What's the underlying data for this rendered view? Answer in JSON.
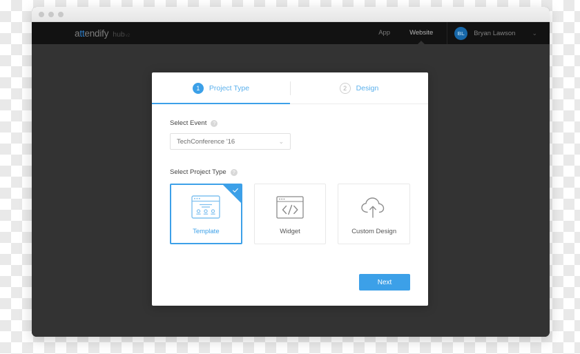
{
  "browser": {
    "traffic_lights": [
      "close",
      "minimize",
      "maximize"
    ]
  },
  "navbar": {
    "logo": {
      "prefix": "a",
      "accent": "tt",
      "suffix": "endify",
      "product": "hub",
      "superscript": "v2"
    },
    "links": [
      {
        "label": "App",
        "active": false
      },
      {
        "label": "Website",
        "active": true
      }
    ],
    "user": {
      "initials": "BL",
      "name": "Bryan Lawson",
      "chevron": "⌄"
    }
  },
  "modal": {
    "tabs": [
      {
        "number": "1",
        "label": "Project Type",
        "state": "active"
      },
      {
        "number": "2",
        "label": "Design",
        "state": "inactive"
      }
    ],
    "select_event": {
      "label": "Select Event",
      "help": "?",
      "value": "TechConference '16",
      "chevron": "⌄"
    },
    "select_project_type": {
      "label": "Select Project Type",
      "help": "?",
      "cards": [
        {
          "label": "Template",
          "icon": "browser-layout-icon",
          "selected": true
        },
        {
          "label": "Widget",
          "icon": "browser-code-icon",
          "selected": false
        },
        {
          "label": "Custom Design",
          "icon": "cloud-upload-icon",
          "selected": false
        }
      ]
    },
    "next_label": "Next"
  },
  "colors": {
    "accent": "#3ca0e8",
    "navbar_bg": "#121212",
    "overlay_bg": "#333333",
    "avatar_bg": "#1767a8"
  }
}
